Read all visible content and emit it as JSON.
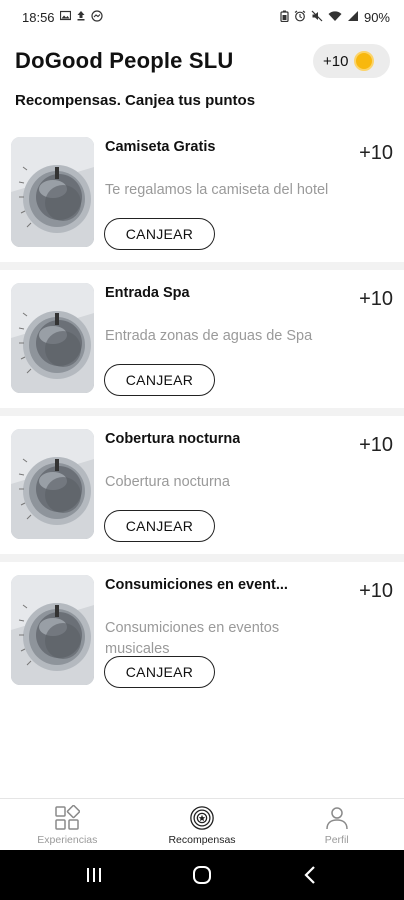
{
  "status_bar": {
    "time": "18:56",
    "battery": "90%",
    "left_icons": [
      "image-icon",
      "upload-icon",
      "messenger-icon"
    ],
    "right_icons": [
      "battery-saver-icon",
      "alarm-icon",
      "mute-icon",
      "wifi-icon",
      "signal-icon"
    ]
  },
  "header": {
    "title": "DoGood People SLU",
    "points": "+10",
    "coin_color": "#f8b80e"
  },
  "subtitle": "Recompensas. Canjea tus puntos",
  "rewards": [
    {
      "title": "Camiseta Gratis",
      "points": "+10",
      "description": "Te regalamos la camiseta del hotel",
      "button": "CANJEAR"
    },
    {
      "title": "Entrada Spa",
      "points": "+10",
      "description": "Entrada zonas de aguas de Spa",
      "button": "CANJEAR"
    },
    {
      "title": "Cobertura nocturna",
      "points": "+10",
      "description": "Cobertura nocturna",
      "button": "CANJEAR"
    },
    {
      "title": "Consumiciones en event...",
      "points": "+10",
      "description": "Consumiciones en eventos musicales",
      "button": "CANJEAR"
    }
  ],
  "bottom_nav": {
    "items": [
      {
        "label": "Experiencias",
        "icon": "grid-icon",
        "active": false
      },
      {
        "label": "Recompensas",
        "icon": "rewards-icon",
        "active": true
      },
      {
        "label": "Perfil",
        "icon": "user-icon",
        "active": false
      }
    ]
  },
  "system_nav": {
    "icons": [
      "recents-icon",
      "home-icon",
      "back-icon"
    ]
  }
}
